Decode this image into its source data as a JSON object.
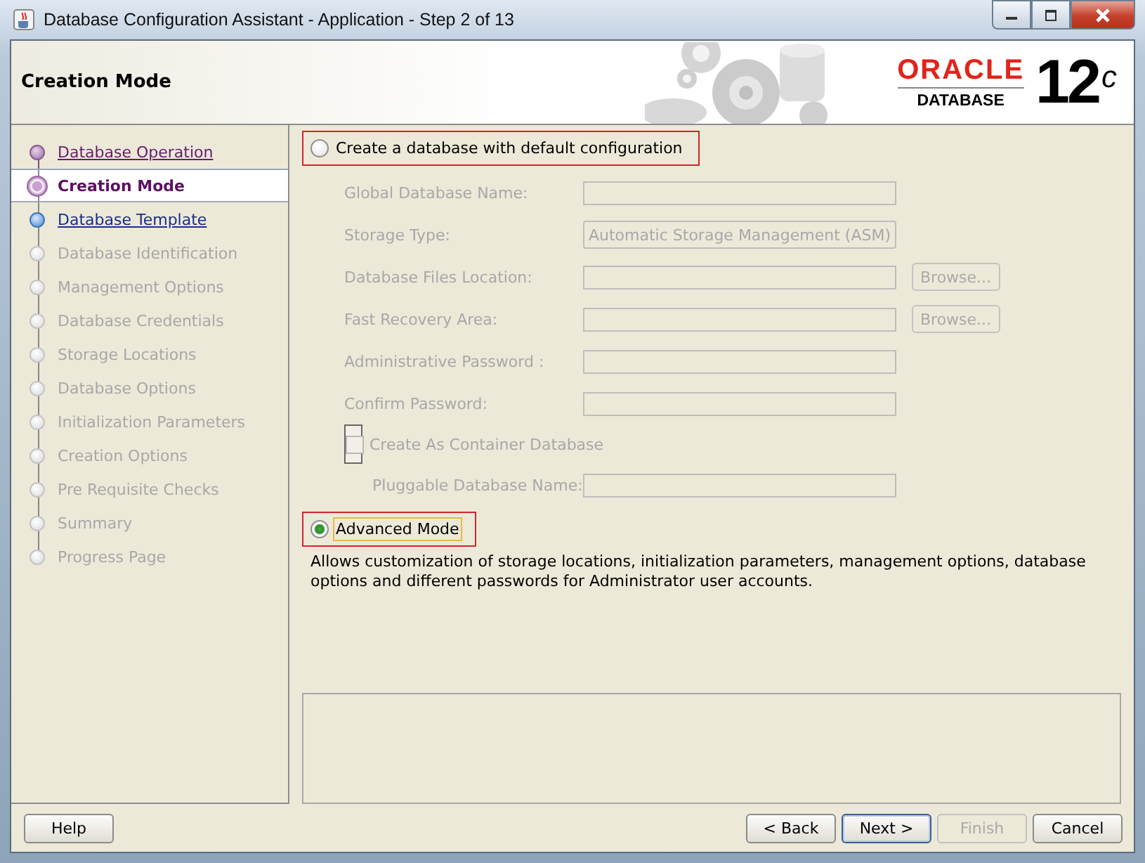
{
  "window": {
    "title": "Database Configuration Assistant - Application - Step 2 of 13"
  },
  "header": {
    "title": "Creation Mode",
    "logo": {
      "brand": "ORACLE",
      "product": "DATABASE",
      "version": "12",
      "version_sup": "c"
    }
  },
  "steps": [
    {
      "label": "Database Operation",
      "kind": "visited",
      "selected": false
    },
    {
      "label": "Creation Mode",
      "kind": "current",
      "selected": true
    },
    {
      "label": "Database Template",
      "kind": "available",
      "selected": false
    },
    {
      "label": "Database Identification",
      "kind": "pending",
      "selected": false
    },
    {
      "label": "Management Options",
      "kind": "pending",
      "selected": false
    },
    {
      "label": "Database Credentials",
      "kind": "pending",
      "selected": false
    },
    {
      "label": "Storage Locations",
      "kind": "pending",
      "selected": false
    },
    {
      "label": "Database Options",
      "kind": "pending",
      "selected": false
    },
    {
      "label": "Initialization Parameters",
      "kind": "pending",
      "selected": false
    },
    {
      "label": "Creation Options",
      "kind": "pending",
      "selected": false
    },
    {
      "label": "Pre Requisite Checks",
      "kind": "pending",
      "selected": false
    },
    {
      "label": "Summary",
      "kind": "pending",
      "selected": false
    },
    {
      "label": "Progress Page",
      "kind": "pending",
      "selected": false
    }
  ],
  "default_option": {
    "label": "Create a database with default configuration",
    "selected": false,
    "highlighted": true,
    "fields": [
      {
        "kind": "text",
        "label": "Global Database Name:",
        "disabled": true
      },
      {
        "kind": "select",
        "label": "Storage Type:",
        "value": "Automatic Storage Management (ASM)",
        "disabled": true
      },
      {
        "kind": "browse",
        "label": "Database Files Location:",
        "button": "Browse...",
        "disabled": true
      },
      {
        "kind": "browse",
        "label": "Fast Recovery Area:",
        "button": "Browse...",
        "disabled": true
      },
      {
        "kind": "text",
        "label": "Administrative Password :",
        "disabled": true
      },
      {
        "kind": "text",
        "label": "Confirm Password:",
        "disabled": true
      },
      {
        "kind": "checkbox",
        "label": "Create As Container Database",
        "checked": false,
        "disabled": true
      },
      {
        "kind": "subtext",
        "label": "Pluggable Database Name:",
        "disabled": true
      }
    ]
  },
  "advanced_option": {
    "label": "Advanced Mode",
    "selected": true,
    "highlighted": true,
    "focused": true,
    "description": "Allows customization of storage locations, initialization parameters, management options, database options and different passwords for Administrator user accounts."
  },
  "buttons": {
    "left": [
      {
        "label": "Help",
        "disabled": false,
        "default": false
      }
    ],
    "right": [
      {
        "label": "< Back",
        "disabled": false,
        "default": false
      },
      {
        "label": "Next >",
        "disabled": false,
        "default": true
      },
      {
        "label": "Finish",
        "disabled": true,
        "default": false
      },
      {
        "label": "Cancel",
        "disabled": false,
        "default": false
      }
    ]
  }
}
